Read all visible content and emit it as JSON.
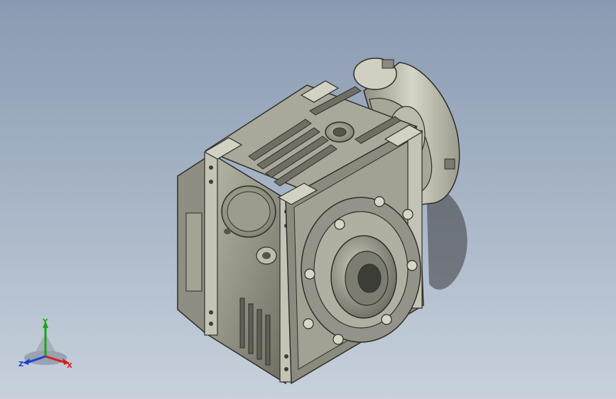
{
  "viewport": {
    "background_top": "#8a9ab1",
    "background_bottom": "#c8d1dc",
    "model": "worm-gearbox-3d-model"
  },
  "triad": {
    "x_label": "X",
    "y_label": "Y",
    "z_label": "Z",
    "x_color": "#d42020",
    "y_color": "#1aa51a",
    "z_color": "#1f3fd1"
  }
}
